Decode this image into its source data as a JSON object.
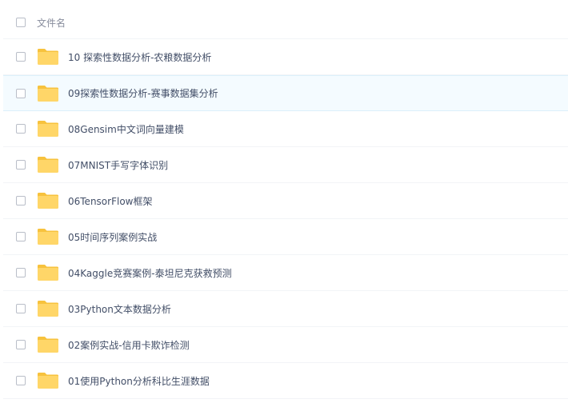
{
  "header": {
    "column_label": "文件名"
  },
  "files": [
    {
      "name": "10 探索性数据分析-农粮数据分析",
      "type": "folder"
    },
    {
      "name": "09探索性数据分析-赛事数据集分析",
      "type": "folder",
      "hovered": true
    },
    {
      "name": "08Gensim中文词向量建模",
      "type": "folder"
    },
    {
      "name": "07MNIST手写字体识别",
      "type": "folder"
    },
    {
      "name": "06TensorFlow框架",
      "type": "folder"
    },
    {
      "name": "05时间序列案例实战",
      "type": "folder"
    },
    {
      "name": "04Kaggle竞赛案例-泰坦尼克获救预测",
      "type": "folder"
    },
    {
      "name": "03Python文本数据分析",
      "type": "folder"
    },
    {
      "name": "02案例实战-信用卡欺诈检测",
      "type": "folder"
    },
    {
      "name": "01使用Python分析科比生涯数据",
      "type": "folder"
    }
  ],
  "colors": {
    "folder_back": "#f7c23d",
    "folder_front": "#ffd668",
    "hover_bg": "#f4fbff"
  },
  "icons": {
    "folder": "folder-icon",
    "checkbox": "checkbox"
  }
}
